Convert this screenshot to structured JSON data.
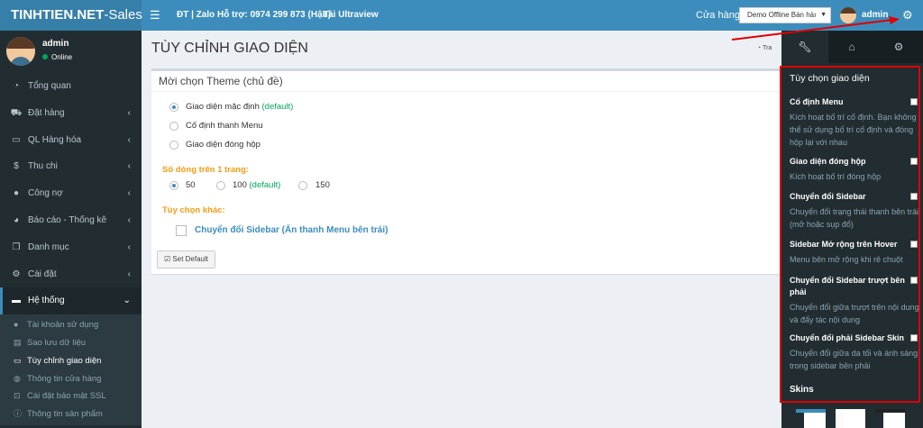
{
  "topbar": {
    "brand_bold": "TINHTIEN.NET",
    "brand_rest": "-Sales",
    "hotline": "ĐT | Zalo Hỗ trợ: 0974 299 873 (Hậu)",
    "ultraview": "Tải Ultraview",
    "store_label": "Cửa hàng",
    "store_selected": "Demo Offline Bán hàı",
    "user": "admin"
  },
  "sidebar": {
    "user": "admin",
    "status": "Online",
    "items": [
      {
        "label": "Tổng quan",
        "icon": "dashboard-icon"
      },
      {
        "label": "Đặt hàng",
        "icon": "cart-icon"
      },
      {
        "label": "QL Hàng hóa",
        "icon": "credit-card-icon"
      },
      {
        "label": "Thu chi",
        "icon": "dollar-icon"
      },
      {
        "label": "Công nợ",
        "icon": "user-icon"
      },
      {
        "label": "Báo cáo - Thống kê",
        "icon": "pie-chart-icon"
      },
      {
        "label": "Danh mục",
        "icon": "copy-icon"
      },
      {
        "label": "Cài đặt",
        "icon": "gear-icon"
      },
      {
        "label": "Hệ thống",
        "icon": "laptop-icon"
      }
    ],
    "subitems": [
      {
        "label": "Tài khoản sử dụng",
        "icon": "user-icon"
      },
      {
        "label": "Sao lưu dữ liệu",
        "icon": "database-icon"
      },
      {
        "label": "Tùy chỉnh giao diện",
        "icon": "credit-card-icon"
      },
      {
        "label": "Thông tin cửa hàng",
        "icon": "globe-icon"
      },
      {
        "label": "Cài đặt bảo mật SSL",
        "icon": "lock-icon"
      },
      {
        "label": "Thông tin sản phẩm",
        "icon": "info-icon"
      }
    ]
  },
  "content": {
    "title": "TÙY CHỈNH GIAO DIỆN",
    "breadcrumb": "Tra",
    "box_title": "Mời chọn Theme (chủ đề)",
    "themes": [
      {
        "label": "Giao diện mặc định",
        "suffix": "(default)",
        "selected": true
      },
      {
        "label": "Cố định thanh Menu",
        "suffix": "",
        "selected": false
      },
      {
        "label": "Giao diện đóng hộp",
        "suffix": "",
        "selected": false
      }
    ],
    "rows_label": "Số dòng trên 1 trang:",
    "rows": [
      {
        "label": "50",
        "suffix": "",
        "selected": true
      },
      {
        "label": "100",
        "suffix": "(default)",
        "selected": false
      },
      {
        "label": "150",
        "suffix": "",
        "selected": false
      }
    ],
    "other_label": "Tùy chọn khác:",
    "sidebar_toggle": "Chuyển đổi Sidebar (Ẩn thanh Menu bên trái)",
    "set_default": "Set Default"
  },
  "control": {
    "title": "Tùy chọn giao diện",
    "items": [
      {
        "head": "Cố định Menu",
        "desc": "Kích hoạt bố trí cố định. Bạn không thể sử dụng bố trí cố định và đóng hộp lại với nhau"
      },
      {
        "head": "Giao diện đóng hộp",
        "desc": "Kích hoạt bố trí đóng hộp"
      },
      {
        "head": "Chuyển đổi Sidebar",
        "desc": "Chuyển đổi trạng thái thanh bên trái (mở hoặc sụp đổ)"
      },
      {
        "head": "Sidebar Mở rộng trên Hover",
        "desc": "Menu bên mở rộng khi rê chuột"
      },
      {
        "head": "Chuyển đổi Sidebar trượt bên phải",
        "desc": "Chuyển đổi giữa trượt trên nội dung và đẩy tác nội dung"
      },
      {
        "head": "Chuyển đổi phải Sidebar Skin",
        "desc": "Chuyển đổi giữa da tối và ánh sáng trong sidebar bên phải"
      }
    ],
    "skins": "Skins"
  },
  "colors": {
    "accent": "#3c8dbc",
    "sidebar": "#222d32",
    "highlight": "#e00000",
    "success": "#00a65a",
    "warning": "#f39c12"
  }
}
